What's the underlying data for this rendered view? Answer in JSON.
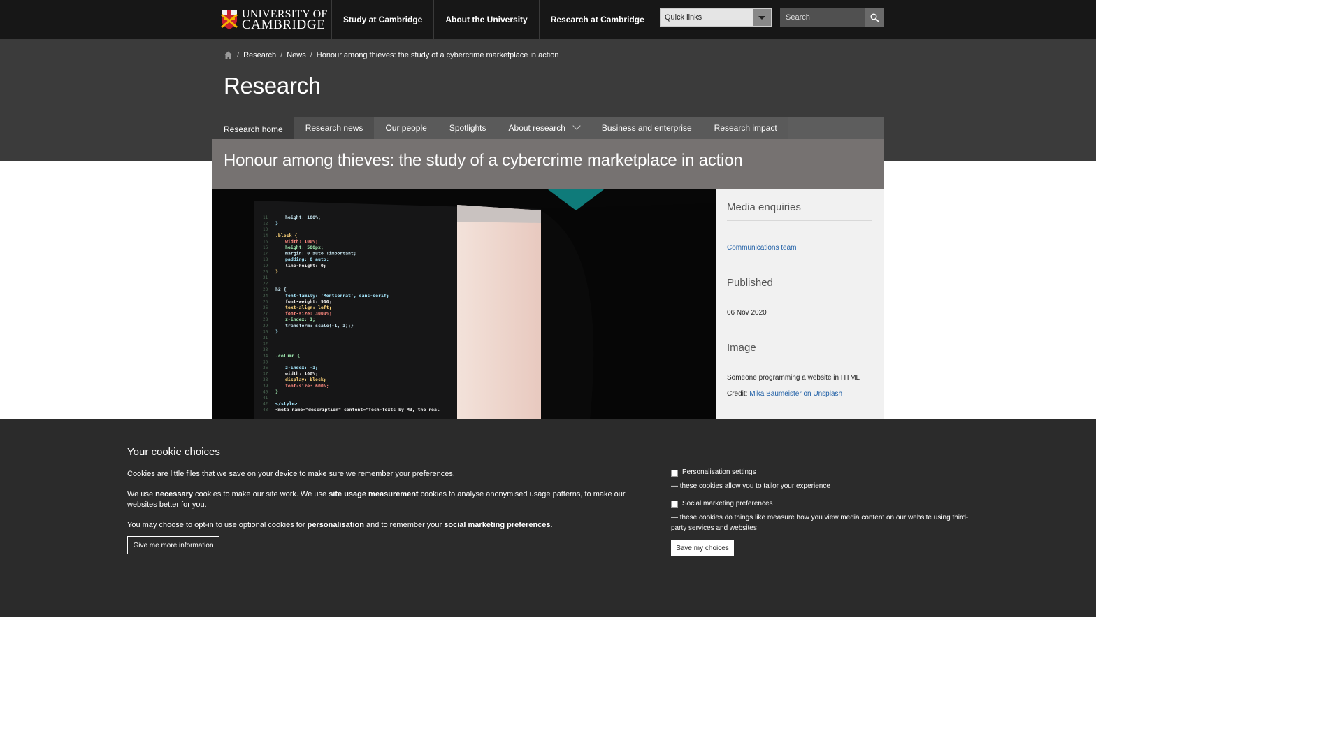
{
  "brand": {
    "line1": "UNIVERSITY OF",
    "line2": "CAMBRIDGE"
  },
  "topnav": [
    "Study at Cambridge",
    "About the University",
    "Research at Cambridge"
  ],
  "quicklinks": {
    "label": "Quick links"
  },
  "search": {
    "placeholder": "Search"
  },
  "breadcrumb": [
    "Research",
    "News",
    "Honour among thieves: the study of a cybercrime marketplace in action"
  ],
  "section_title": "Research",
  "secnav": [
    "Research home",
    "Research news",
    "Our people",
    "Spotlights",
    "About research",
    "Business and enterprise",
    "Research impact"
  ],
  "article": {
    "title": "Honour among thieves: the study of a cybercrime marketplace in action"
  },
  "sidebar": {
    "media_heading": "Media enquiries",
    "media_link": "Communications team",
    "published_heading": "Published",
    "published_date": "06 Nov 2020",
    "image_heading": "Image",
    "image_caption": "Someone programming a website in HTML",
    "credit_label": "Credit:",
    "credit_link": "Mika Baumeister on Unsplash"
  },
  "cookie": {
    "title": "Your cookie choices",
    "p1": "Cookies are little files that we save on your device to make sure we remember your preferences.",
    "p2_a": "We use ",
    "p2_b": "necessary",
    "p2_c": " cookies to make our site work. We use ",
    "p2_d": "site usage measurement",
    "p2_e": " cookies to analyse anonymised usage patterns, to make our websites better for you.",
    "p3_a": "You may choose to opt-in to use optional cookies for ",
    "p3_b": "personalisation",
    "p3_c": " and to remember your ",
    "p3_d": "social marketing preferences",
    "p3_e": ".",
    "info_button": "Give me more information",
    "opt1_label": "Personalisation settings",
    "opt1_desc": "— these cookies allow you to tailor your experience",
    "opt2_label": "Social marketing preferences",
    "opt2_desc": "— these cookies do things like measure how you view media content on our website using third-party services and websites",
    "save_button": "Save my choices"
  },
  "code_lines": [
    "height: 100%;",
    "}",
    "",
    ".block {",
    "width: 100%;",
    "height: 500px;",
    "margin: 0 auto !important;",
    "padding: 0 auto;",
    "line-height: 0;",
    "}",
    "",
    "",
    "h2 {",
    "font-family: 'Montserrat', sans-serif;",
    "font-weight: 900;",
    "text-align: left;",
    "font-size: 3000%;",
    "z-index: 1;",
    "transform: scale(-1, 1);}",
    "}",
    "",
    "",
    "",
    ".column {",
    "",
    "z-index: -1;",
    "width: 100%;",
    "display: block;",
    "font-size: 600%;",
    "}",
    "",
    "</style>",
    "<meta name=\"description\" content=\"Tech-Texts by MB, the real"
  ],
  "colors": {
    "top": "#171717",
    "header": "#3b3b3b",
    "headline": "#767271",
    "link": "#1f5fa6",
    "cookie": "#2b2b2b"
  }
}
